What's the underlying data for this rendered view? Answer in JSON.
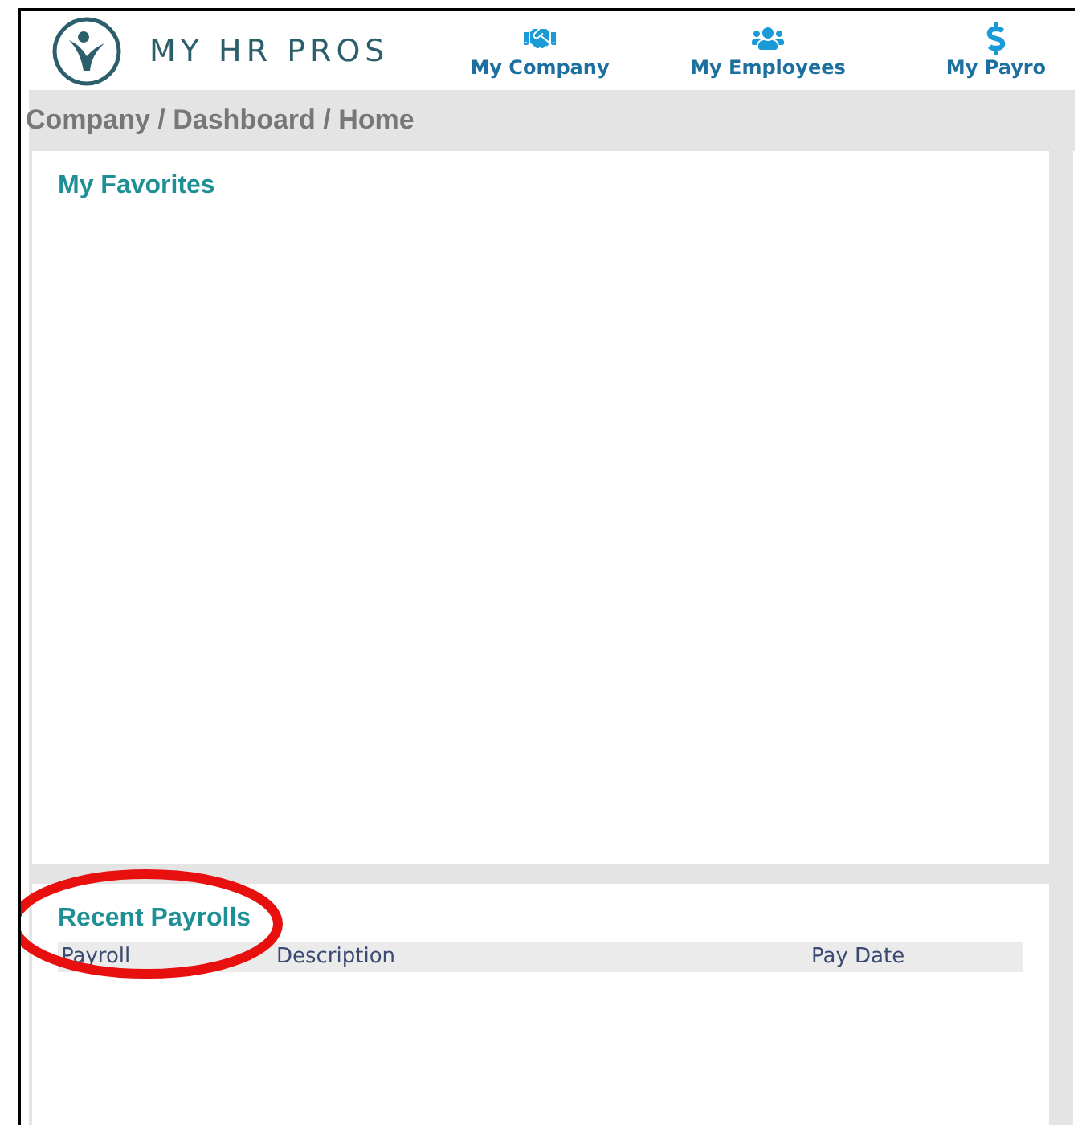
{
  "header": {
    "logo_text": "MY HR PROS",
    "nav": [
      {
        "label": "My Company"
      },
      {
        "label": "My Employees"
      },
      {
        "label": "My Payro"
      }
    ]
  },
  "breadcrumb": "Company / Dashboard / Home",
  "favorites": {
    "title": "My Favorites"
  },
  "recent_payrolls": {
    "title": "Recent Payrolls",
    "columns": [
      "Payroll",
      "Description",
      "Pay Date"
    ]
  }
}
